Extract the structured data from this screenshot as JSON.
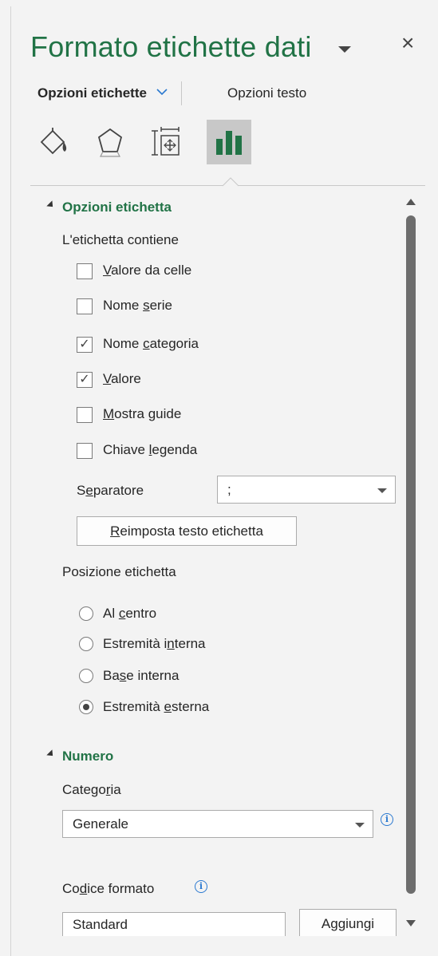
{
  "pane": {
    "title": "Formato etichette dati",
    "close_glyph": "×"
  },
  "subtabs": {
    "active": "Opzioni etichette",
    "inactive": "Opzioni testo"
  },
  "category_icons": [
    {
      "name": "fill-line-icon",
      "selected": false
    },
    {
      "name": "effects-icon",
      "selected": false
    },
    {
      "name": "size-properties-icon",
      "selected": false
    },
    {
      "name": "label-options-icon",
      "selected": true
    }
  ],
  "label_options": {
    "section_title": "Opzioni etichetta",
    "contains_label": "L'etichetta contiene",
    "checkboxes": [
      {
        "pre": "",
        "u": "V",
        "post": "alore da celle",
        "checked": false
      },
      {
        "pre": "Nome ",
        "u": "s",
        "post": "erie",
        "checked": false
      },
      {
        "pre": "Nome ",
        "u": "c",
        "post": "ategoria",
        "checked": true
      },
      {
        "pre": "",
        "u": "V",
        "post": "alore",
        "checked": true
      },
      {
        "pre": "",
        "u": "M",
        "post": "ostra guide",
        "checked": false
      },
      {
        "pre": "Chiave ",
        "u": "l",
        "post": "egenda",
        "checked": false
      }
    ],
    "separator_label_pre": "S",
    "separator_label_u": "e",
    "separator_label_post": "paratore",
    "separator_value": ";",
    "reset_button_u": "R",
    "reset_button_post": "eimposta testo etichetta",
    "position_label": "Posizione etichetta",
    "radios": [
      {
        "pre": "Al ",
        "u": "c",
        "post": "entro",
        "selected": false
      },
      {
        "pre": "Estremità i",
        "u": "n",
        "post": "terna",
        "selected": false
      },
      {
        "pre": "Ba",
        "u": "s",
        "post": "e interna",
        "selected": false
      },
      {
        "pre": "Estremità ",
        "u": "e",
        "post": "sterna",
        "selected": true
      }
    ]
  },
  "number": {
    "section_title": "Numero",
    "category_label_pre": "Catego",
    "category_label_u": "r",
    "category_label_post": "ia",
    "category_value": "Generale",
    "format_code_label_pre": "Co",
    "format_code_label_u": "d",
    "format_code_label_post": "ice formato",
    "format_code_value": "Standard",
    "add_button": "Aggiungi"
  },
  "colors": {
    "accent_green": "#217346",
    "info_blue": "#2b79d0",
    "pane_bg": "#f3f3f3"
  }
}
